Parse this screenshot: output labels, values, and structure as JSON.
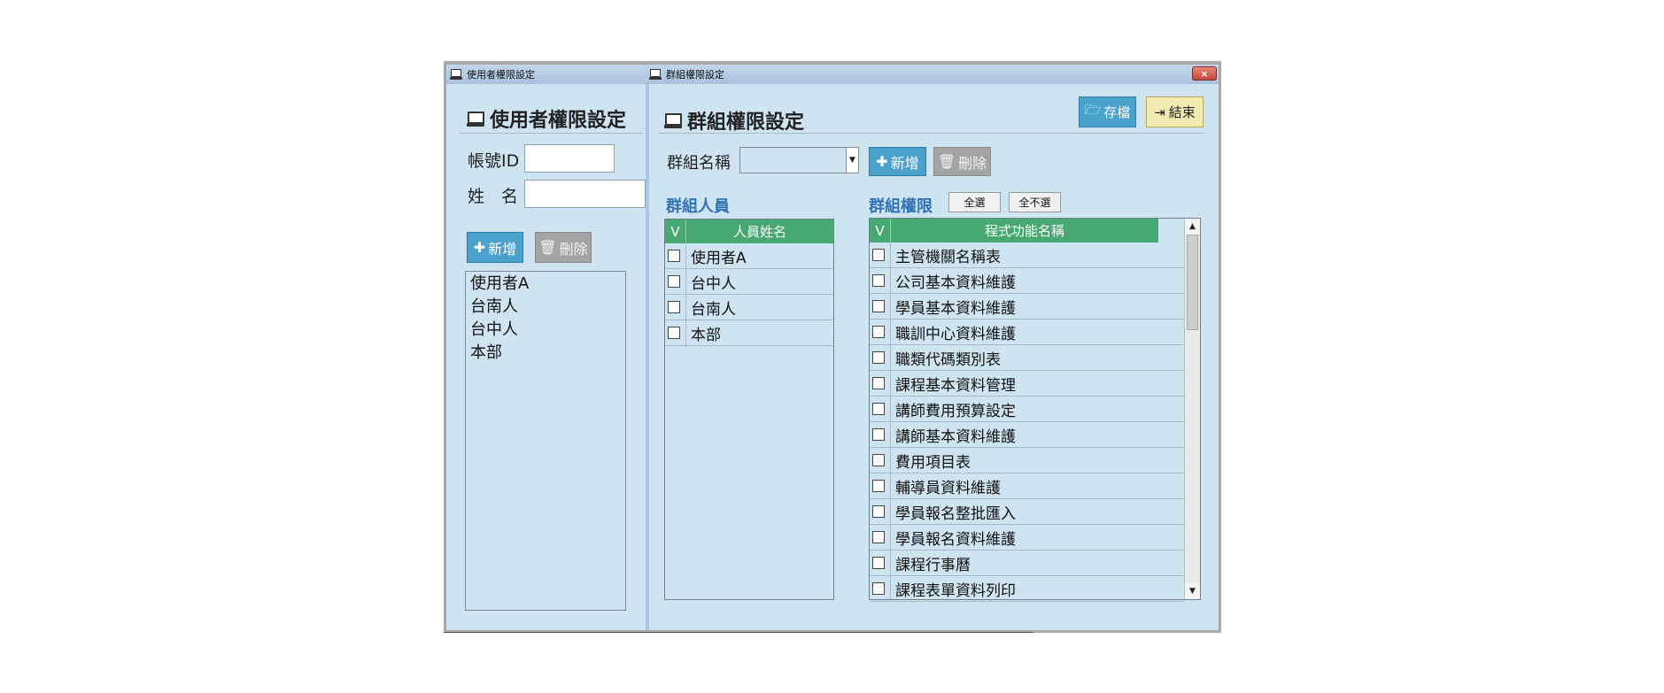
{
  "tabs": {
    "user_tab": "使用者權限設定",
    "group_tab": "群組權限設定"
  },
  "close_label": "×",
  "user_panel": {
    "title": "使用者權限設定",
    "account_label": "帳號ID",
    "account_value": "",
    "name_label": "姓　名",
    "name_value": "",
    "add_label": "新增",
    "delete_label": "刪除",
    "users": [
      "使用者A",
      "台南人",
      "台中人",
      "本部"
    ]
  },
  "group_panel": {
    "title": "群組權限設定",
    "save_label": "存檔",
    "exit_label": "結束",
    "group_name_label": "群組名稱",
    "group_name_value": "",
    "add_label": "新增",
    "delete_label": "刪除",
    "members_title": "群組人員",
    "members_check_header": "V",
    "members_name_header": "人員姓名",
    "members": [
      "使用者A",
      "台中人",
      "台南人",
      "本部"
    ],
    "perms_title": "群組權限",
    "select_all_label": "全選",
    "deselect_all_label": "全不選",
    "perms_check_header": "V",
    "perms_name_header": "程式功能名稱",
    "permissions": [
      "主管機關名稱表",
      "公司基本資料維護",
      "學員基本資料維護",
      "職訓中心資料維護",
      "職類代碼類別表",
      "課程基本資料管理",
      "講師費用預算設定",
      "講師基本資料維護",
      "費用項目表",
      "輔導員資料維護",
      "學員報名整批匯入",
      "學員報名資料維護",
      "課程行事曆",
      "課程表單資料列印"
    ]
  },
  "colors": {
    "panel_bg": "#cfe4f1",
    "header_green": "#47a871",
    "button_blue": "#4aa1cb",
    "subtitle_blue": "#2f73b5"
  }
}
